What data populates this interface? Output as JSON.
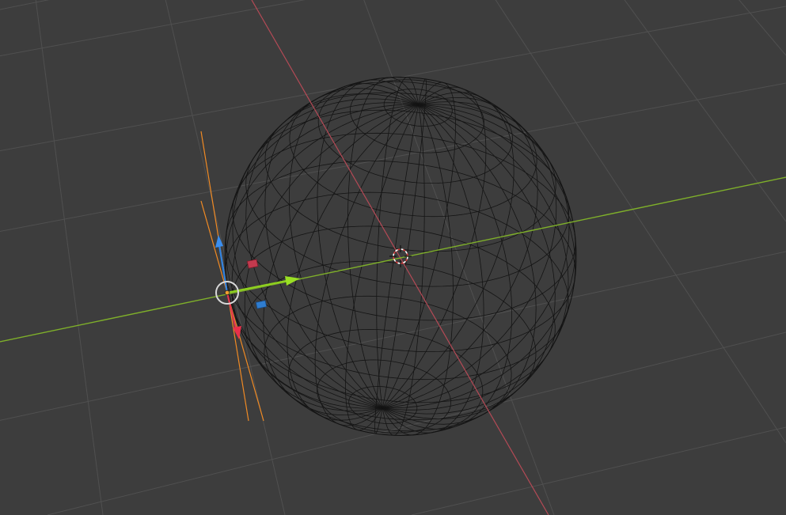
{
  "viewport": {
    "background_color": "#3d3d3d",
    "grid_color": "#4f4f4f",
    "x_axis_color": "#b44a56",
    "y_axis_color": "#7fb02a",
    "mesh_color": "#111111"
  },
  "scene": {
    "object": "uv-sphere",
    "display_mode": "wireframe",
    "selected": false,
    "origin_marker": "3d-cursor"
  },
  "gizmo": {
    "type": "move-gizmo",
    "axis_x_color": "#e0364f",
    "axis_y_color": "#8fd11f",
    "axis_z_color": "#2f82e0",
    "plane_xz_color": "#c23a4e",
    "plane_xy_color": "#2f7dd0",
    "guide_color": "#f08a24",
    "center_ring_color": "#d9d9d9"
  }
}
